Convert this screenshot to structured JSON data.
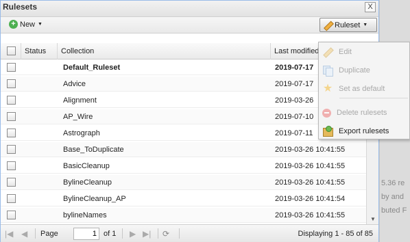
{
  "dialog": {
    "title": "Rulesets",
    "close_label": "X"
  },
  "toolbar": {
    "new_label": "New",
    "ruleset_label": "Ruleset"
  },
  "grid": {
    "columns": [
      "Status",
      "Collection",
      "Last modified"
    ],
    "rows": [
      {
        "collection": "Default_Ruleset",
        "modified": "2019-07-17",
        "bold": true
      },
      {
        "collection": "Advice",
        "modified": "2019-07-17",
        "bold": false
      },
      {
        "collection": "Alignment",
        "modified": "2019-03-26",
        "bold": false
      },
      {
        "collection": "AP_Wire",
        "modified": "2019-07-10",
        "bold": false
      },
      {
        "collection": "Astrograph",
        "modified": "2019-07-11",
        "bold": false
      },
      {
        "collection": "Base_ToDuplicate",
        "modified": "2019-03-26 10:41:55",
        "bold": false
      },
      {
        "collection": "BasicCleanup",
        "modified": "2019-03-26 10:41:55",
        "bold": false
      },
      {
        "collection": "BylineCleanup",
        "modified": "2019-03-26 10:41:55",
        "bold": false
      },
      {
        "collection": "BylineCleanup_AP",
        "modified": "2019-03-26 10:41:54",
        "bold": false
      },
      {
        "collection": "bylineNames",
        "modified": "2019-03-26 10:41:55",
        "bold": false
      }
    ]
  },
  "pager": {
    "page_label": "Page",
    "page_value": "1",
    "of_label": "of 1",
    "display_info": "Displaying 1 - 85 of 85"
  },
  "menu": {
    "items": [
      {
        "label": "Edit",
        "enabled": false,
        "icon": "pencil-icon"
      },
      {
        "label": "Duplicate",
        "enabled": false,
        "icon": "duplicate-icon"
      },
      {
        "label": "Set as default",
        "enabled": false,
        "icon": "star-icon"
      },
      {
        "label": "Delete rulesets",
        "enabled": false,
        "icon": "delete-icon"
      },
      {
        "label": "Export rulesets",
        "enabled": true,
        "icon": "export-icon"
      }
    ]
  },
  "background": {
    "fragments": [
      "5.36 re",
      "by and",
      "buted F"
    ]
  },
  "colors": {
    "title_border": "#99bbe8",
    "new_icon": "#4caf50",
    "delete_icon": "#ef9a9a"
  }
}
